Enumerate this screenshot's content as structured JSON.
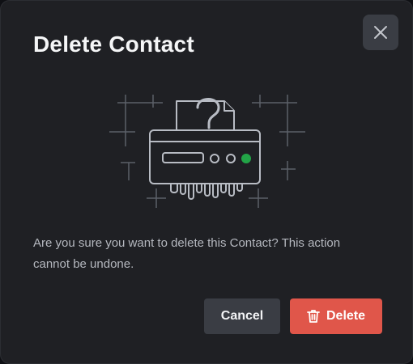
{
  "dialog": {
    "title": "Delete Contact",
    "message": "Are you sure you want to delete this Contact? This action cannot be undone.",
    "close_icon": "close-icon",
    "illustration_icon": "shredder-question-illustration",
    "buttons": {
      "cancel_label": "Cancel",
      "delete_label": "Delete",
      "delete_icon": "trash-icon"
    },
    "colors": {
      "background": "#1f2024",
      "title": "#f5f6f7",
      "message": "#b5b8bf",
      "secondary_button": "#3a3d44",
      "danger_button": "#e0564a",
      "indicator_light": "#22a447"
    }
  }
}
